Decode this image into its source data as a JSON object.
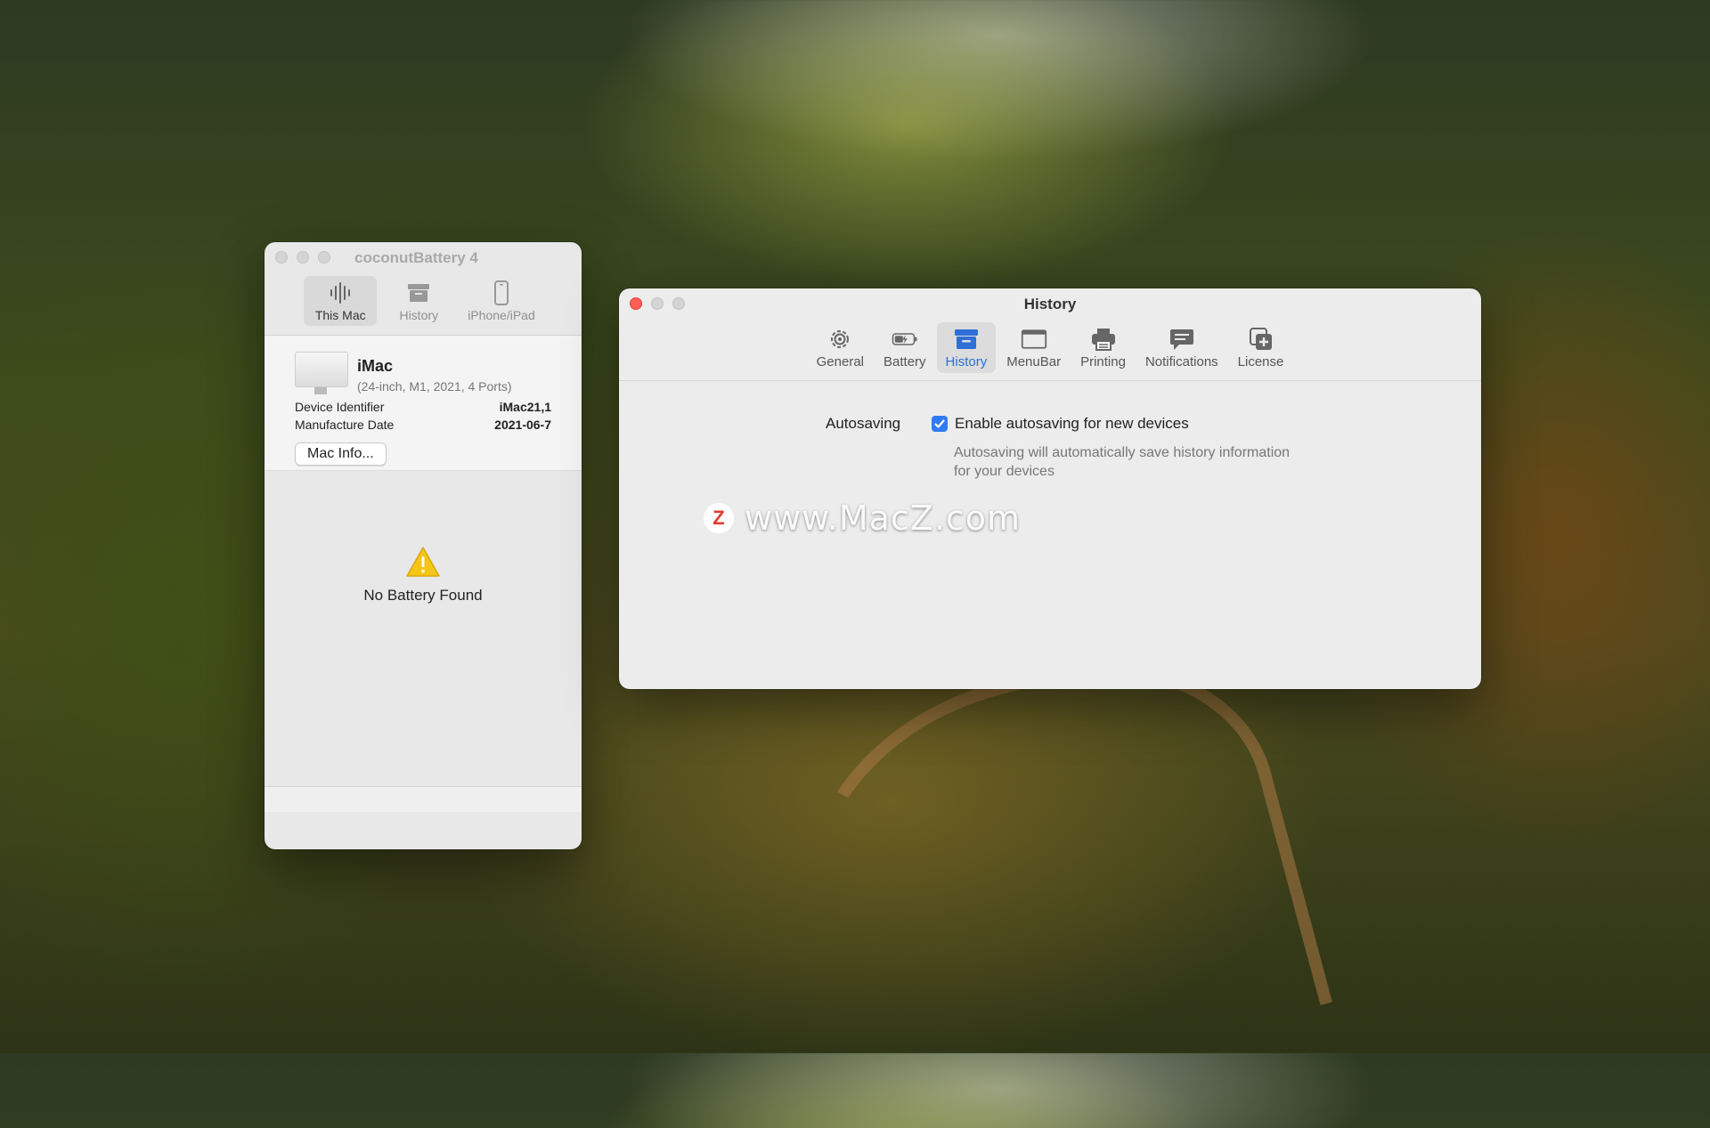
{
  "coconut": {
    "title": "coconutBattery 4",
    "tabs": [
      {
        "label": "This Mac",
        "icon": "battery-waveform-icon"
      },
      {
        "label": "History",
        "icon": "archive-box-icon"
      },
      {
        "label": "iPhone/iPad",
        "icon": "iphone-icon"
      }
    ],
    "device": {
      "name": "iMac",
      "subtitle": "(24-inch, M1, 2021, 4 Ports)",
      "id_label": "Device Identifier",
      "id_value": "iMac21,1",
      "date_label": "Manufacture Date",
      "date_value": "2021-06-7",
      "button": "Mac Info..."
    },
    "empty_message": "No Battery Found"
  },
  "prefs": {
    "title": "History",
    "tabs": [
      {
        "label": "General",
        "icon": "gear-icon"
      },
      {
        "label": "Battery",
        "icon": "battery-charging-icon"
      },
      {
        "label": "History",
        "icon": "tray-icon"
      },
      {
        "label": "MenuBar",
        "icon": "window-icon"
      },
      {
        "label": "Printing",
        "icon": "printer-icon"
      },
      {
        "label": "Notifications",
        "icon": "message-bubble-icon"
      },
      {
        "label": "License",
        "icon": "license-add-icon"
      }
    ],
    "active_tab": "History",
    "field_label": "Autosaving",
    "checkbox_label": "Enable autosaving for new devices",
    "checkbox_checked": true,
    "help_text": "Autosaving will automatically save history information for your devices"
  },
  "watermark": {
    "logo": "Z",
    "text": "www.MacZ.com"
  },
  "colors": {
    "accent": "#2f6fd6",
    "checkbox": "#2f7bf5",
    "close": "#ff5f57"
  }
}
